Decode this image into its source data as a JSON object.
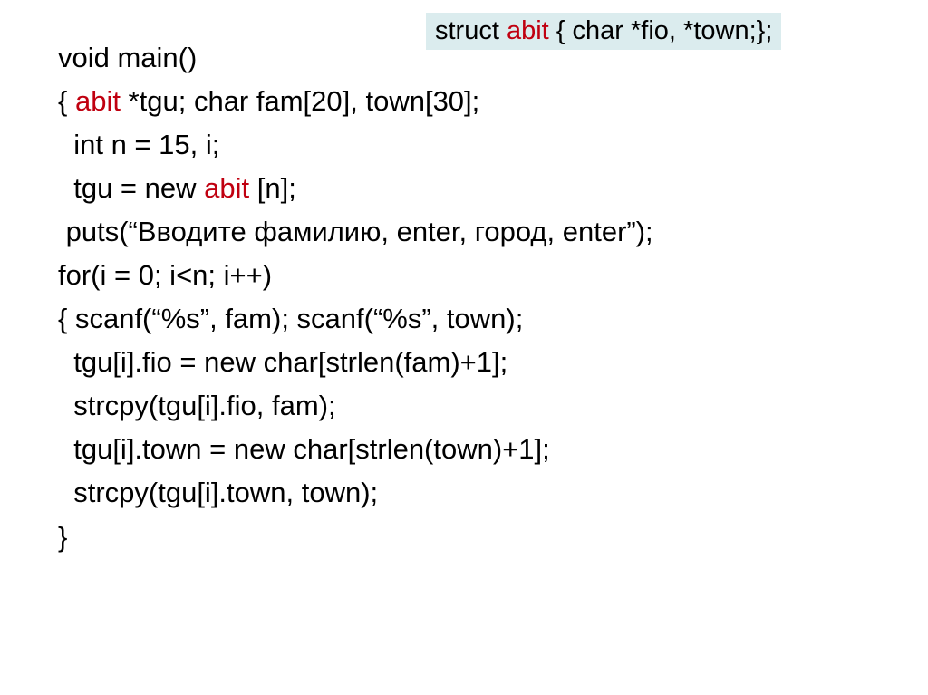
{
  "header": {
    "t0": "struct ",
    "k0": "abit",
    "t1": " { char *fio, *town;};"
  },
  "code": {
    "l1a": "void main()",
    "l2a": "{ ",
    "l2k": "abit",
    "l2b": " *tgu; char fam[20], town[30];",
    "l3a": "  int n = 15, i;",
    "l4a": "  tgu = new ",
    "l4k": "abit",
    "l4b": " [n]; ",
    "l5a": " puts(“Вводите фамилию, enter, город, enter”);",
    "l6a": "for(i = 0; i<n; i++)",
    "l7a": "{ scanf(“%s”, fam); scanf(“%s”, town);",
    "l8a": "  tgu[i].fio = new char[strlen(fam)+1];",
    "l9a": "  strcpy(tgu[i].fio, fam);",
    "l10a": "  tgu[i].town = new char[strlen(town)+1];",
    "l11a": "  strcpy(tgu[i].town, town);",
    "l12a": "}"
  }
}
